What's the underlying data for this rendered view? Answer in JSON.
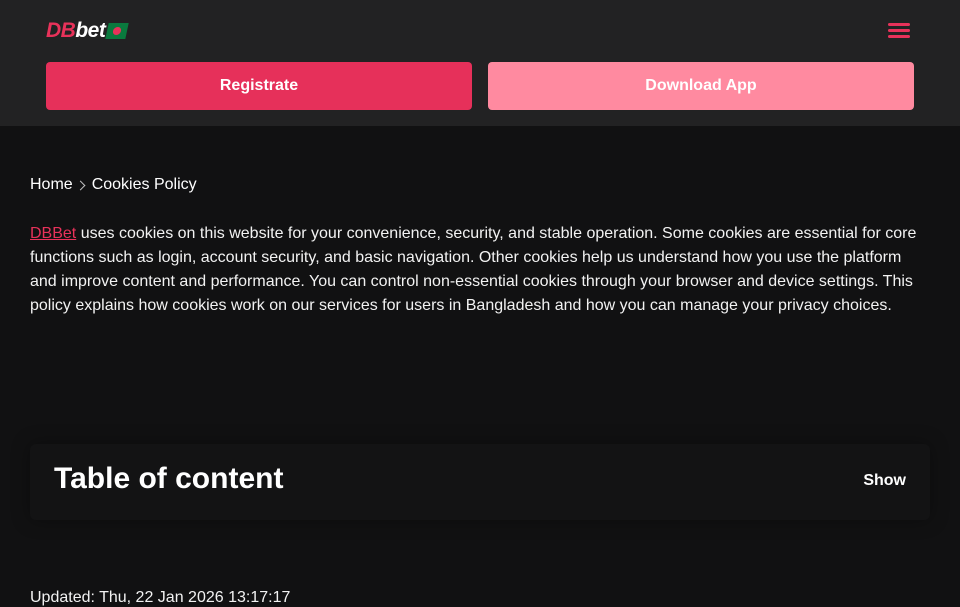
{
  "header": {
    "logo_db": "DB",
    "logo_bet": "bet",
    "register_label": "Registrate",
    "download_label": "Download App"
  },
  "breadcrumb": {
    "home": "Home",
    "current": "Cookies Policy"
  },
  "intro": {
    "brand_link": "DBBet",
    "text": " uses cookies on this website for your convenience, security, and stable operation. Some cookies are essential for core functions such as login, account security, and basic navigation. Other cookies help us understand how you use the platform and improve content and performance. You can control non-essential cookies through your browser and device settings. This policy explains how cookies work on our services for users in Bangladesh and how you can manage your privacy choices."
  },
  "toc": {
    "title": "Table of content",
    "toggle_label": "Show"
  },
  "updated": "Updated: Thu, 22 Jan 2026 13:17:17",
  "colors": {
    "accent": "#e6305a",
    "accent_light": "#ff8aa0",
    "header_bg": "#222223",
    "page_bg": "#111112"
  },
  "icons": {
    "menu": "hamburger-menu-icon",
    "breadcrumb_separator": "chevron-right-icon"
  }
}
